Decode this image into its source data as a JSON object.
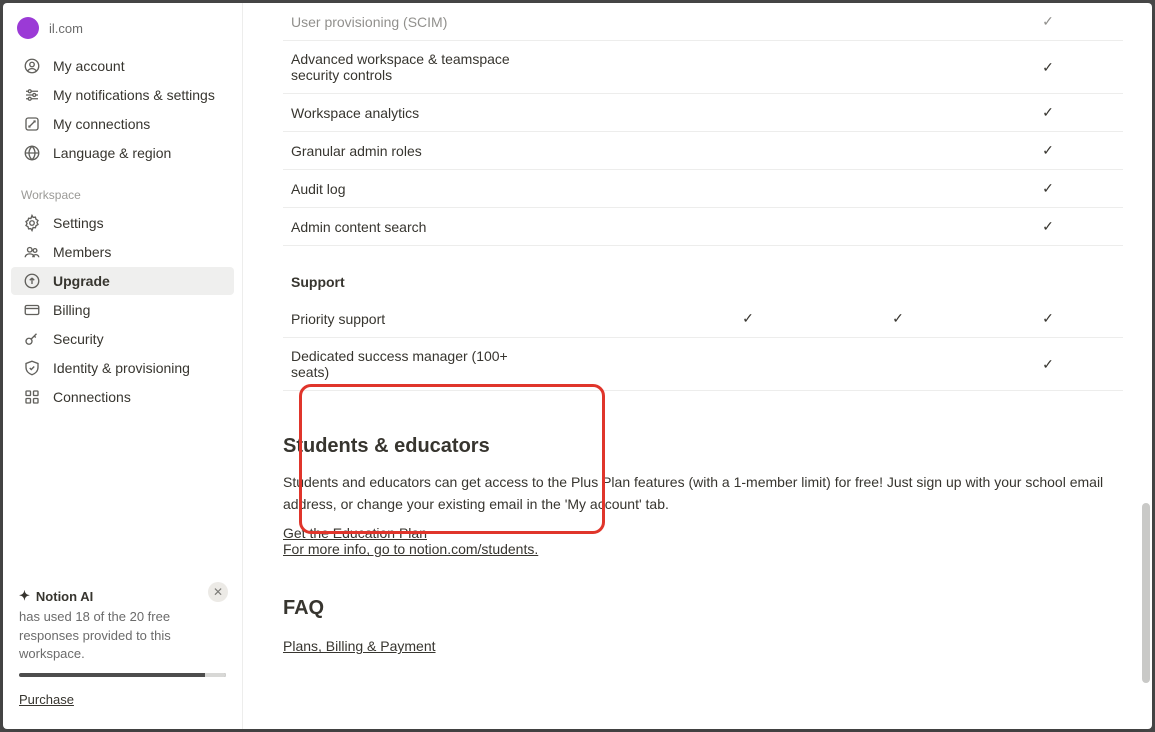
{
  "account": {
    "email_suffix": "il.com",
    "avatar_initial": ""
  },
  "sidebar": {
    "account_items": [
      {
        "icon": "user-circle",
        "label": "My account"
      },
      {
        "icon": "sliders",
        "label": "My notifications & settings"
      },
      {
        "icon": "link-box",
        "label": "My connections"
      },
      {
        "icon": "globe",
        "label": "Language & region"
      }
    ],
    "workspace_label": "Workspace",
    "workspace_items": [
      {
        "icon": "gear",
        "label": "Settings"
      },
      {
        "icon": "people",
        "label": "Members"
      },
      {
        "icon": "arrow-up-circle",
        "label": "Upgrade",
        "active": true
      },
      {
        "icon": "card",
        "label": "Billing"
      },
      {
        "icon": "key",
        "label": "Security"
      },
      {
        "icon": "shield-check",
        "label": "Identity & provisioning"
      },
      {
        "icon": "grid",
        "label": "Connections"
      }
    ],
    "ai": {
      "title": "Notion AI",
      "desc": "has used 18 of the 20 free responses provided to this workspace.",
      "purchase": "Purchase"
    }
  },
  "table": {
    "rows": [
      {
        "label": "User provisioning (SCIM)",
        "cols": [
          "",
          "",
          "",
          "✓"
        ],
        "faded": true
      },
      {
        "label": "Advanced workspace & teamspace security controls",
        "cols": [
          "",
          "",
          "",
          "✓"
        ]
      },
      {
        "label": "Workspace analytics",
        "cols": [
          "",
          "",
          "",
          "✓"
        ]
      },
      {
        "label": "Granular admin roles",
        "cols": [
          "",
          "",
          "",
          "✓"
        ]
      },
      {
        "label": "Audit log",
        "cols": [
          "",
          "",
          "",
          "✓"
        ]
      },
      {
        "label": "Admin content search",
        "cols": [
          "",
          "",
          "",
          "✓"
        ]
      }
    ],
    "support_header": "Support",
    "support_rows": [
      {
        "label": "Priority support",
        "cols": [
          "",
          "✓",
          "✓",
          "✓"
        ]
      },
      {
        "label": "Dedicated success manager (100+ seats)",
        "cols": [
          "",
          "",
          "",
          "✓"
        ]
      }
    ]
  },
  "edu": {
    "title": "Students & educators",
    "desc": "Students and educators can get access to the Plus Plan features (with a 1-member limit) for free! Just sign up with your school email address, or change your existing email in the 'My account' tab.",
    "link1": "Get the Education Plan",
    "link2": "For more info, go to notion.com/students."
  },
  "faq": {
    "title": "FAQ",
    "link": "Plans, Billing & Payment"
  }
}
